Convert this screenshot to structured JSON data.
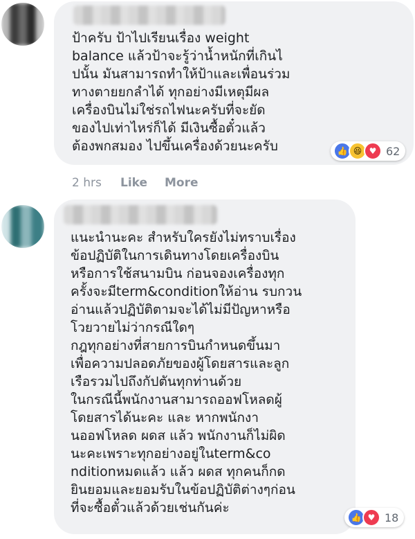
{
  "comments": [
    {
      "lines": [
        "ป้าครับ ป้าไปเรียนเรื่อง weight",
        "balance แล้วป้าจะรู้ว่าน้ำหนักที่เกินไ",
        "ปนั้น มันสามารถทำให้ป้าและเพื่อนร่วม",
        "ทางตายยกลำได้ ทุกอย่างมีเหตุมีผล",
        "เครื่องบินไม่ใช่รถไฟนะครับที่จะยัด",
        "ของไปเท่าไหร่ก็ได้ มีเงินซื้อตั๋วแล้ว",
        "ต้องพกสมอง ไปขึ้นเครื่องด้วยนะครับ"
      ],
      "reactions": {
        "icons": [
          "like-icon",
          "haha-icon",
          "love-icon"
        ],
        "count": "62"
      },
      "time": "2 hrs",
      "like_label": "Like",
      "more_label": "More"
    },
    {
      "lines": [
        "แนะนำนะคะ สำหรับใครยังไม่ทราบเรื่อง",
        "ข้อปฏิบัติในการเดินทางโดยเครื่องบิน",
        "หรือการใช้สนามบิน ก่อนจองเครื่องทุก",
        "ครั้งจะมีterm&conditionให้อ่าน รบกวน",
        "อ่านแล้วปฏิบัติตามจะได้ไม่มีปัญหาหรือ",
        "โวยวายไม่ว่ากรณีใดๆ",
        "กฎทุกอย่างที่สายการบินกำหนดขึ้นมา",
        "เพื่อความปลอดภัยของผู้โดยสารและลูก",
        "เรือรวมไปถึงกัปตันทุกท่านด้วย",
        "ในกรณีนี้พนักงานสามารถออฟโหลดผู้",
        "โดยสารได้นะคะ และ หากพนักงา",
        "นออฟโหลด ผดส แล้ว พนักงานก็ไม่ผิด",
        "นะคะเพราะทุกอย่างอยู่ในterm&co",
        "nditionหมดแล้ว แล้ว ผดส ทุกคนก็กด",
        "ยินยอมและยอมรับในข้อปฏิบัติต่างๆก่อน",
        "ที่จะซื้อตั๋วแล้วด้วยเช่นกันค่ะ"
      ],
      "reactions": {
        "icons": [
          "like-icon",
          "love-icon"
        ],
        "count": "18"
      }
    }
  ],
  "colors": {
    "bubble": "#f0f1f3",
    "text": "#1c1e21",
    "meta": "#8d949e",
    "like": "#4a77e8",
    "love": "#ee3b51",
    "haha": "#f7c331"
  },
  "glyphs": {
    "like": "👍",
    "haha": "😆",
    "love": "♥"
  }
}
